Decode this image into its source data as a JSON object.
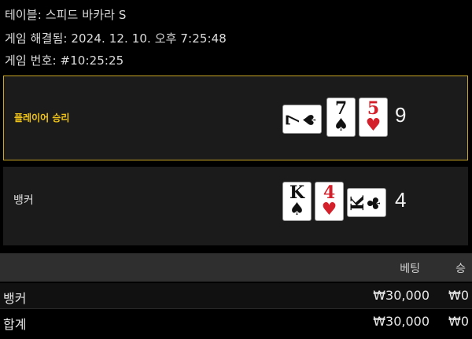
{
  "info": {
    "table": "테이블: 스피드 바카라 S",
    "resolved": "게임 해결됨: 2024. 12. 10. 오후 7:25:48",
    "game_no": "게임 번호: #10:25:25"
  },
  "player": {
    "label": "플레이어 승리",
    "score": "9",
    "cards": [
      {
        "rank": "7",
        "suit": "♠",
        "orientation": "side",
        "color": "black"
      },
      {
        "rank": "7",
        "suit": "♠",
        "orientation": "up",
        "color": "black"
      },
      {
        "rank": "5",
        "suit": "♥",
        "orientation": "up",
        "color": "red"
      }
    ]
  },
  "banker": {
    "label": "뱅커",
    "score": "4",
    "cards": [
      {
        "rank": "K",
        "suit": "♠",
        "orientation": "up",
        "color": "black"
      },
      {
        "rank": "4",
        "suit": "♥",
        "orientation": "up",
        "color": "red"
      },
      {
        "rank": "K",
        "suit": "♣",
        "orientation": "side",
        "color": "black"
      }
    ]
  },
  "table": {
    "headers": [
      "베팅",
      "승"
    ],
    "rows": [
      {
        "name": "뱅커",
        "bet": "₩30,000",
        "win": "₩0"
      },
      {
        "name": "합계",
        "bet": "₩30,000",
        "win": "₩0"
      }
    ]
  },
  "colors": {
    "winner_border": "#c9a526",
    "winner_text": "#f0c419",
    "heart_red": "#d4202a"
  }
}
